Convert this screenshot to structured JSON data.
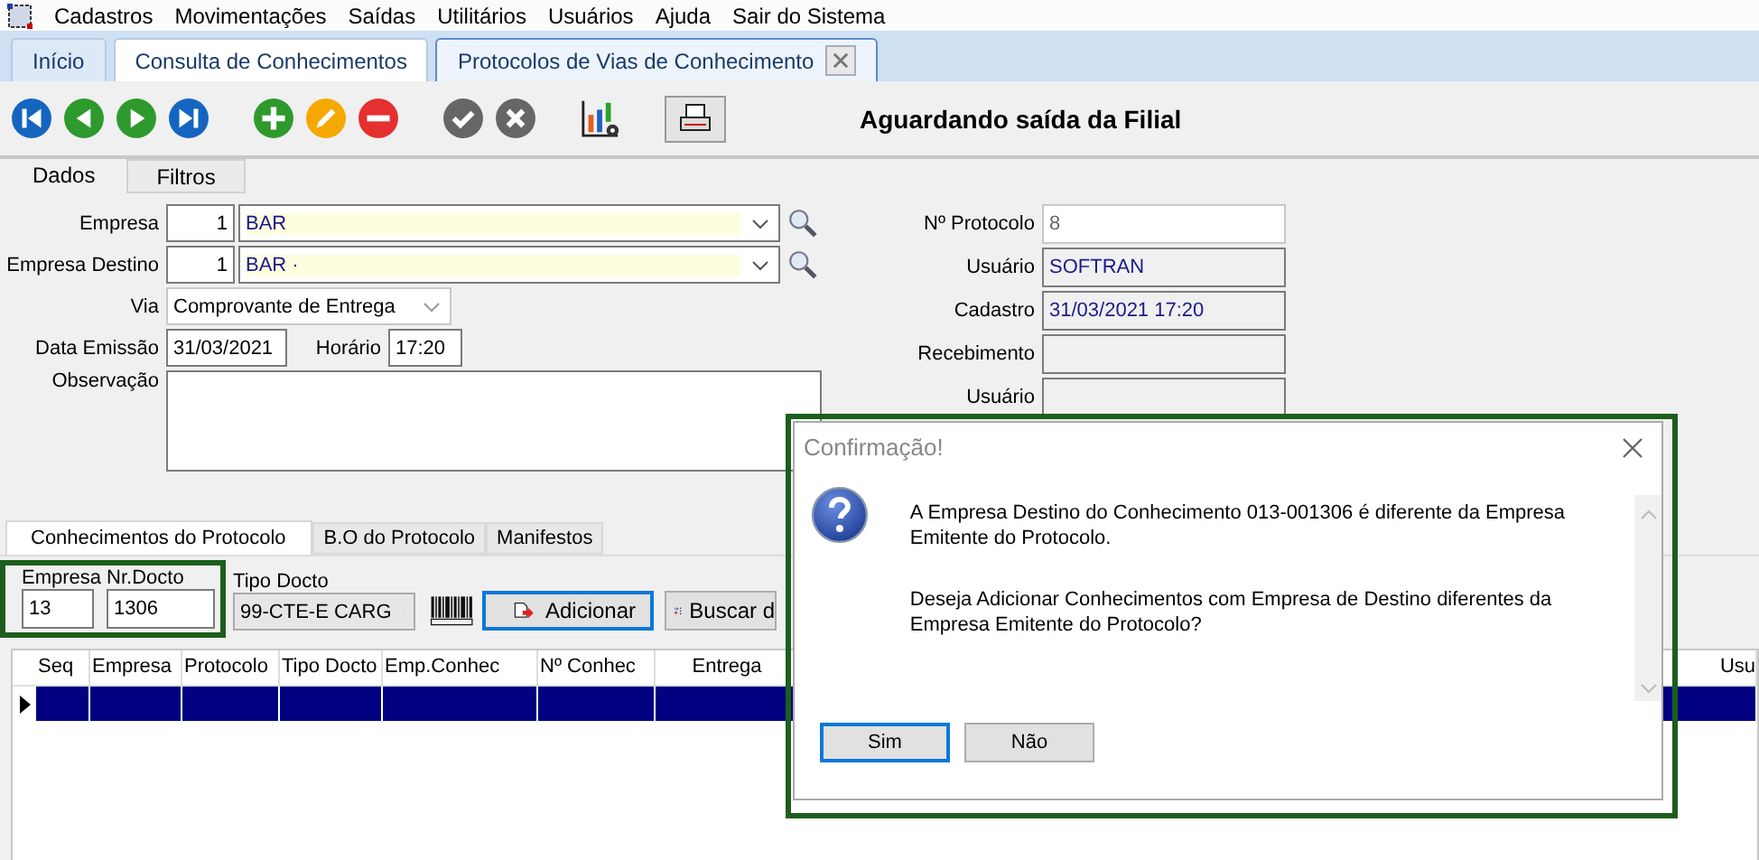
{
  "menu": [
    "Cadastros",
    "Movimentações",
    "Saídas",
    "Utilitários",
    "Usuários",
    "Ajuda",
    "Sair do Sistema"
  ],
  "tabs": [
    {
      "label": "Início",
      "selected": false,
      "closable": false
    },
    {
      "label": "Consulta de Conhecimentos",
      "selected": false,
      "closable": false
    },
    {
      "label": "Protocolos de Vias de Conhecimento",
      "selected": true,
      "closable": true
    }
  ],
  "status_title": "Aguardando saída da Filial",
  "subtabs": [
    {
      "label": "Dados",
      "selected": true
    },
    {
      "label": "Filtros",
      "selected": false
    }
  ],
  "form": {
    "empresa": {
      "label": "Empresa",
      "code": "1",
      "name": "BAR"
    },
    "empresa_destino": {
      "label": "Empresa Destino",
      "code": "1",
      "name": "BAR ·"
    },
    "via": {
      "label": "Via",
      "value": "Comprovante de Entrega"
    },
    "data_emissao": {
      "label": "Data Emissão",
      "value": "31/03/2021"
    },
    "horario": {
      "label": "Horário",
      "value": "17:20"
    },
    "observacao": {
      "label": "Observação"
    }
  },
  "info": [
    {
      "label": "Nº Protocolo",
      "value": "8",
      "kind": "plain"
    },
    {
      "label": "Usuário",
      "value": "SOFTRAN",
      "kind": "readonly"
    },
    {
      "label": "Cadastro",
      "value": "31/03/2021 17:20",
      "kind": "readonly"
    },
    {
      "label": "Recebimento",
      "kind": "readonly"
    },
    {
      "label": "Usuário",
      "kind": "readonly"
    }
  ],
  "bottom_tabs": [
    {
      "label": "Conhecimentos do Protocolo",
      "selected": true
    },
    {
      "label": "B.O do Protocolo",
      "selected": false
    },
    {
      "label": "Manifestos",
      "selected": false
    }
  ],
  "entry": {
    "empresa": {
      "label": "Empresa",
      "value": "13"
    },
    "nr_docto": {
      "label": "Nr.Docto",
      "value": "1306"
    },
    "tipo_docto": {
      "label": "Tipo Docto",
      "value": "99-CTE-E CARG"
    },
    "add_button": "Adicionar",
    "search_button": "Buscar d"
  },
  "table": {
    "columns": [
      "Seq",
      "Empresa",
      "Protocolo",
      "Tipo Docto",
      "Emp.Conhec",
      "Nº Conhec",
      "Entrega",
      "Usu"
    ],
    "rows": [
      {
        "selected": true
      }
    ]
  },
  "dialog": {
    "title": "Confirmação!",
    "paragraphs": [
      "A Empresa Destino do Conhecimento 013-001306 é diferente da Empresa Emitente do Protocolo.",
      "Deseja Adicionar Conhecimentos com Empresa de Destino diferentes da Empresa Emitente do Protocolo?"
    ],
    "buttons": [
      {
        "label": "Sim",
        "default": true
      },
      {
        "label": "Não",
        "default": false
      }
    ]
  }
}
